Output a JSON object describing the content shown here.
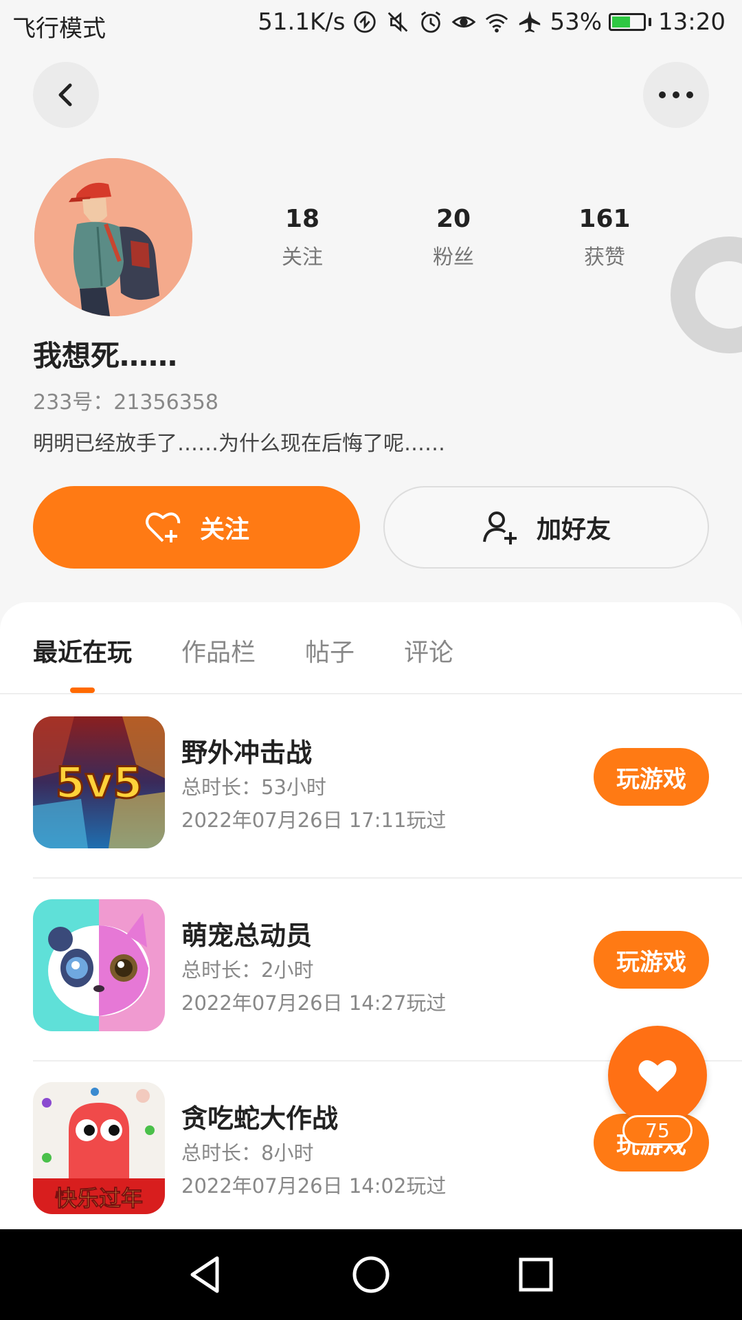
{
  "status_bar": {
    "mode": "飞行模式",
    "speed": "51.1K/s",
    "battery": "53%",
    "time": "13:20",
    "icons": [
      "data-saver-icon",
      "mute-icon",
      "alarm-icon",
      "eye-icon",
      "wifi-icon",
      "airplane-icon",
      "battery-icon"
    ]
  },
  "nav": {
    "back_icon": "chevron-left-icon",
    "more_icon": "more-dots-icon"
  },
  "profile": {
    "stats": [
      {
        "value": "18",
        "label": "关注"
      },
      {
        "value": "20",
        "label": "粉丝"
      },
      {
        "value": "161",
        "label": "获赞"
      }
    ],
    "nickname": "我想死……",
    "uid": "233号：21356358",
    "bio": "明明已经放手了……为什么现在后悔了呢……"
  },
  "actions": {
    "follow": "关注",
    "add_friend": "加好友"
  },
  "tabs": [
    "最近在玩",
    "作品栏",
    "帖子",
    "评论"
  ],
  "games": [
    {
      "name": "野外冲击战",
      "duration": "总时长：53小时",
      "last_played": "2022年07月26日 17:11玩过",
      "button": "玩游戏",
      "icon_text": "5v5"
    },
    {
      "name": "萌宠总动员",
      "duration": "总时长：2小时",
      "last_played": "2022年07月26日 14:27玩过",
      "button": "玩游戏"
    },
    {
      "name": "贪吃蛇大作战",
      "duration": "总时长：8小时",
      "last_played": "2022年07月26日 14:02玩过",
      "button": "玩游戏",
      "icon_text": "快乐过年"
    }
  ],
  "like_fab": {
    "count": "75"
  },
  "colors": {
    "accent": "#ff7a14",
    "tab_indicator": "#ff6a00"
  }
}
